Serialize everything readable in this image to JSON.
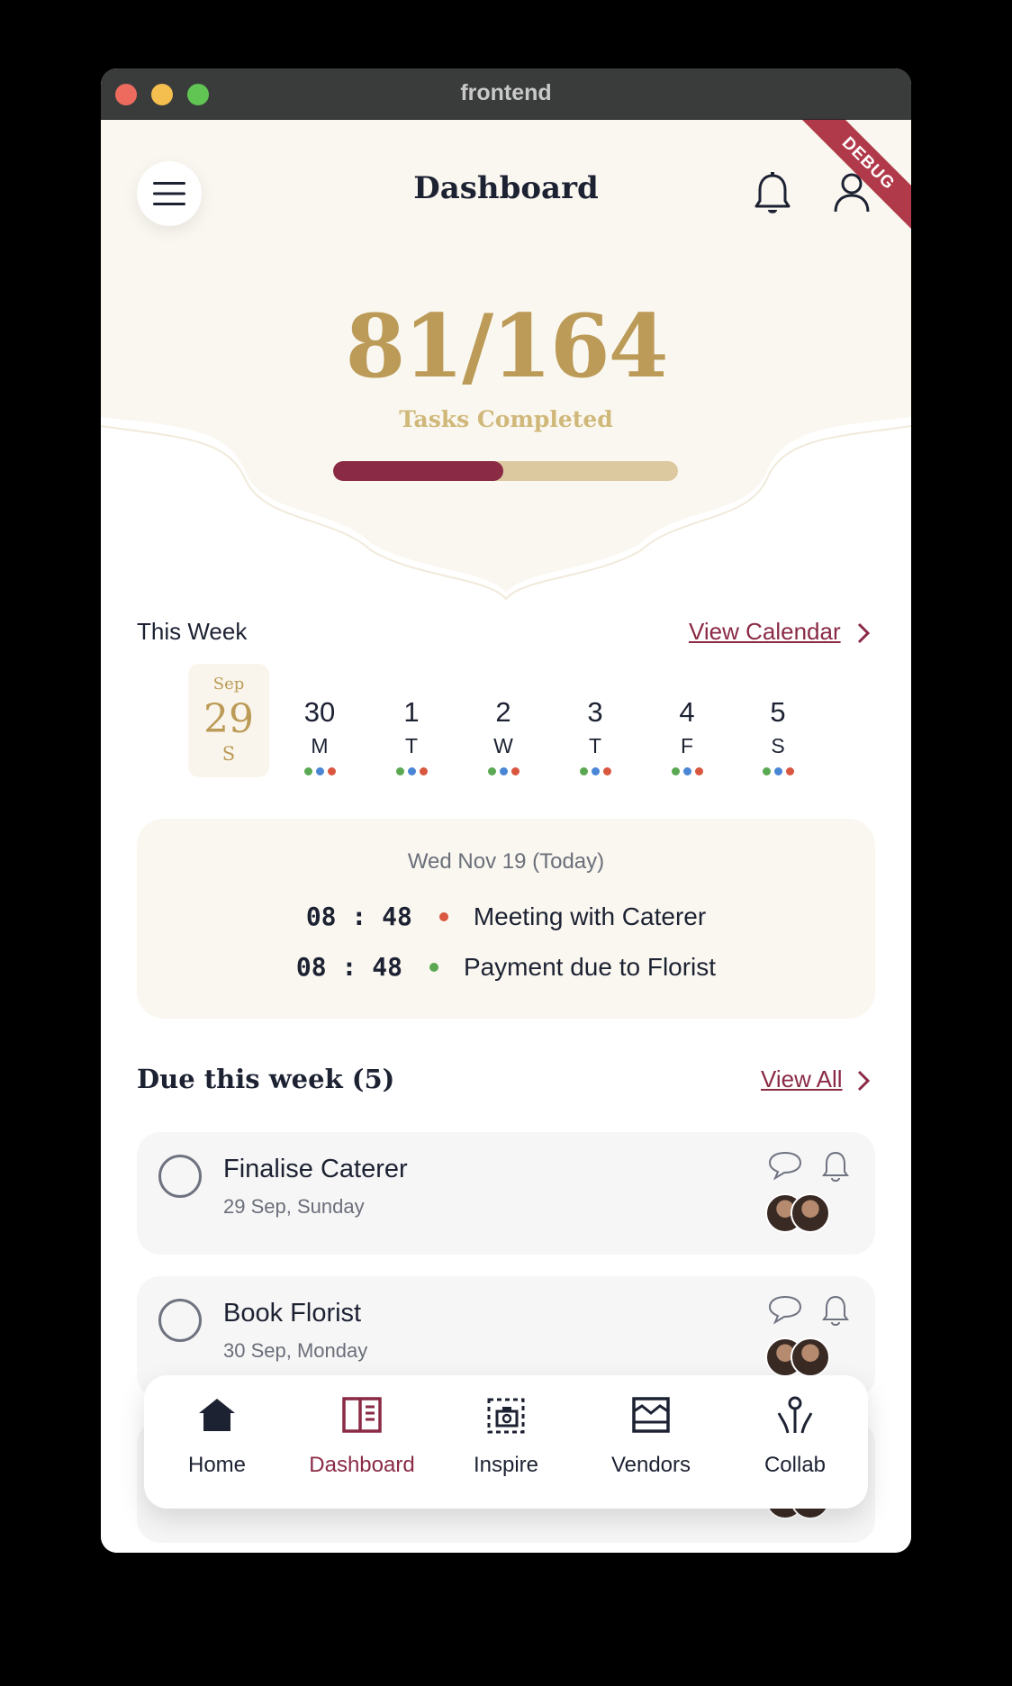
{
  "window": {
    "title": "frontend"
  },
  "header": {
    "title": "Dashboard",
    "debug_banner": "DEBUG"
  },
  "progress": {
    "completed": 81,
    "total": 164,
    "count_text": "81/164",
    "label": "Tasks Completed",
    "fraction": 0.494
  },
  "week": {
    "title": "This Week",
    "view_calendar": "View Calendar",
    "days": [
      {
        "month": "Sep",
        "num": "29",
        "weekday": "S",
        "selected": true
      },
      {
        "month": "",
        "num": "30",
        "weekday": "M",
        "selected": false
      },
      {
        "month": "",
        "num": "1",
        "weekday": "T",
        "selected": false
      },
      {
        "month": "",
        "num": "2",
        "weekday": "W",
        "selected": false
      },
      {
        "month": "",
        "num": "3",
        "weekday": "T",
        "selected": false
      },
      {
        "month": "",
        "num": "4",
        "weekday": "F",
        "selected": false
      },
      {
        "month": "",
        "num": "5",
        "weekday": "S",
        "selected": false
      }
    ],
    "dot_colors": [
      "#5aa852",
      "#4a86d6",
      "#d9573f"
    ]
  },
  "today": {
    "date": "Wed Nov 19 (Today)",
    "events": [
      {
        "time": "08 : 48",
        "title": "Meeting with Caterer",
        "color": "#d9573f"
      },
      {
        "time": "08 : 48",
        "title": "Payment due to Florist",
        "color": "#5aa852"
      }
    ]
  },
  "due": {
    "title": "Due this week (5)",
    "view_all": "View All",
    "tasks": [
      {
        "name": "Finalise Caterer",
        "date": "29 Sep, Sunday"
      },
      {
        "name": "Book Florist",
        "date": "30 Sep, Monday"
      },
      {
        "name": "",
        "date": ""
      }
    ]
  },
  "nav": {
    "items": [
      {
        "label": "Home",
        "icon": "home-icon",
        "active": false
      },
      {
        "label": "Dashboard",
        "icon": "dashboard-icon",
        "active": true
      },
      {
        "label": "Inspire",
        "icon": "inspire-icon",
        "active": false
      },
      {
        "label": "Vendors",
        "icon": "vendors-icon",
        "active": false
      },
      {
        "label": "Collab",
        "icon": "collab-icon",
        "active": false
      }
    ]
  },
  "colors": {
    "accent": "#8a2a45",
    "gold": "#bb9b57",
    "cream": "#faf7f0",
    "text": "#1d2233"
  }
}
